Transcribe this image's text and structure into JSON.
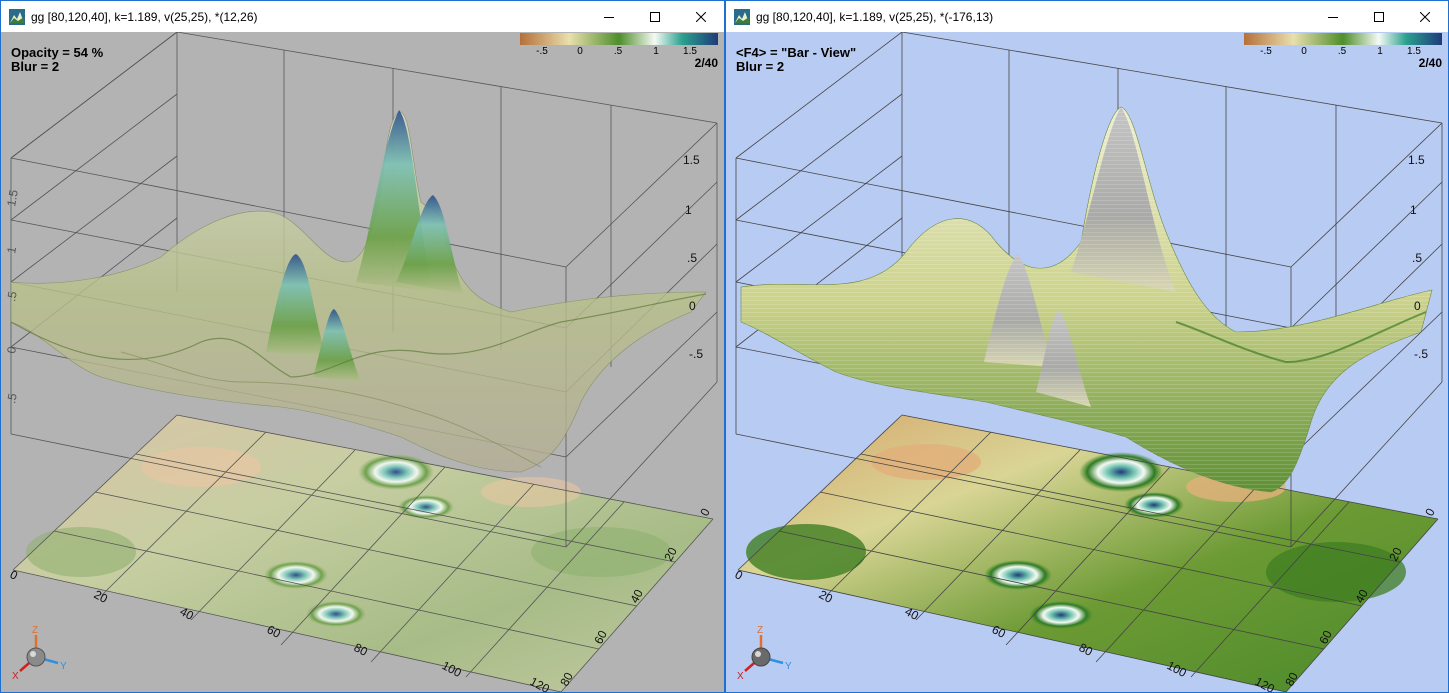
{
  "left_window": {
    "title": "gg [80,120,40], k=1.189, v(25,25), *(12,26)",
    "overlay_line1": "Opacity = 54 %",
    "overlay_line2": "Blur = 2",
    "frame": "2/40",
    "background": "#b3b3b3",
    "x_ticks": [
      "0",
      "20",
      "40",
      "60",
      "80",
      "100",
      "120"
    ],
    "y_ticks": [
      "0",
      "20",
      "40",
      "60",
      "80"
    ],
    "z_ticks_right": [
      "1.5",
      "1",
      ".5",
      "0",
      "-.5"
    ],
    "z_ticks_left": [
      "1.5",
      "1",
      ".5",
      "0",
      ".5"
    ]
  },
  "right_window": {
    "title": "gg [80,120,40], k=1.189, v(25,25), *(-176,13)",
    "overlay_line1": "<F4> = \"Bar - View\"",
    "overlay_line2": "Blur = 2",
    "frame": "2/40",
    "background": "#b8cbf2",
    "x_ticks": [
      "0",
      "20",
      "40",
      "60",
      "80",
      "100",
      "120"
    ],
    "y_ticks": [
      "0",
      "20",
      "40",
      "60",
      "80"
    ],
    "z_ticks_right": [
      "1.5",
      "1",
      ".5",
      "0",
      "-.5"
    ]
  },
  "colorbar": {
    "ticks": [
      "-.5",
      "0",
      ".5",
      "1",
      "1.5"
    ],
    "colors": [
      "#b5703a",
      "#e9dfae",
      "#4e8e2a",
      "#f4faf4",
      "#2aa08e",
      "#1f3b7a"
    ]
  },
  "axes_gizmo": {
    "x_label": "X",
    "y_label": "Y",
    "z_label": "Z"
  },
  "caption_buttons": {
    "minimize_icon": "minimize-icon",
    "maximize_icon": "maximize-icon",
    "close_icon": "close-icon"
  }
}
